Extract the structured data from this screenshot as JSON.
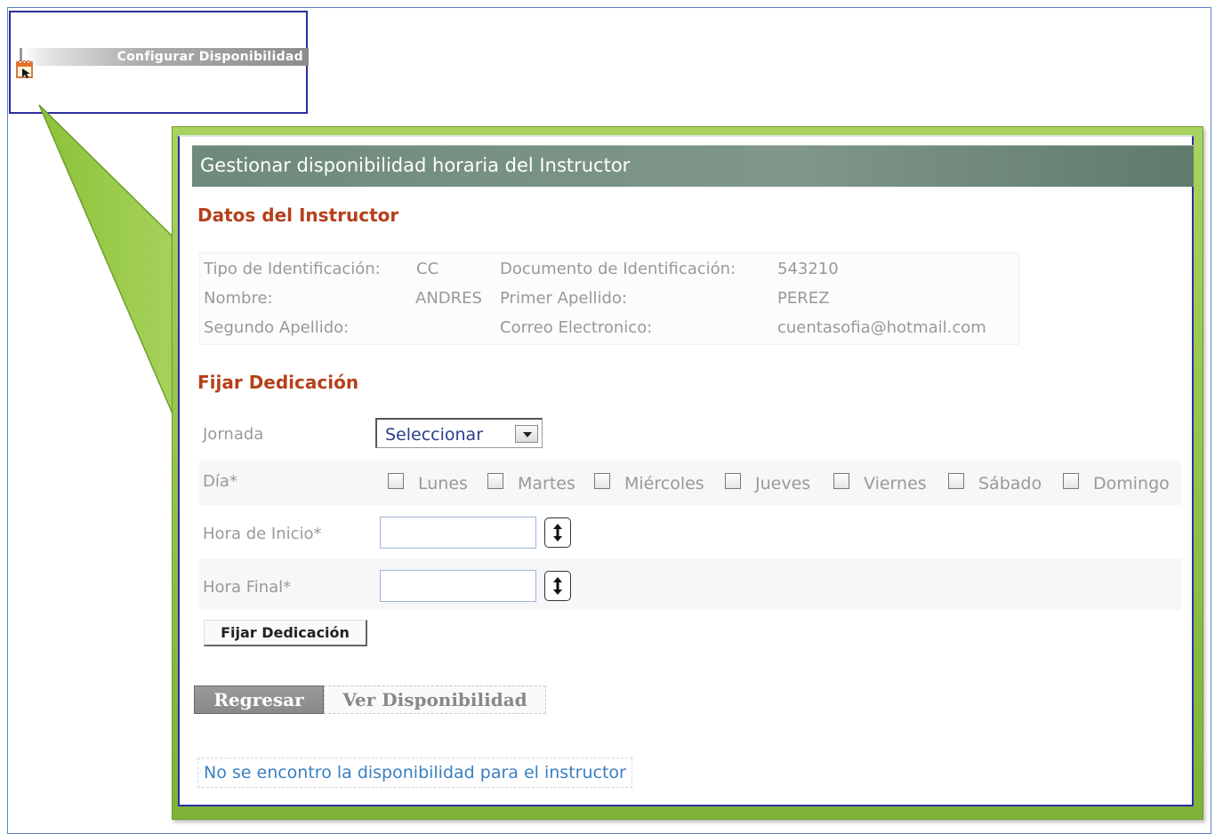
{
  "menu": {
    "title": "Configurar Disponibilidad"
  },
  "panel": {
    "title": "Gestionar disponibilidad horaria del Instructor",
    "section_instructor": "Datos del Instructor",
    "section_dedicacion": "Fijar Dedicación"
  },
  "instructor": {
    "tipo_id_label": "Tipo de Identificación:",
    "tipo_id_value": "CC",
    "documento_label": "Documento de Identificación:",
    "documento_value": "543210",
    "nombre_label": "Nombre:",
    "nombre_value": "ANDRES",
    "primer_apellido_label": "Primer Apellido:",
    "primer_apellido_value": "PEREZ",
    "segundo_apellido_label": "Segundo Apellido:",
    "segundo_apellido_value": "",
    "correo_label": "Correo Electronico:",
    "correo_value": "cuentasofia@hotmail.com"
  },
  "form": {
    "jornada_label": "Jornada",
    "jornada_selected": "Seleccionar",
    "dia_label": "Día*",
    "days": [
      "Lunes",
      "Martes",
      "Miércoles",
      "Jueves",
      "Viernes",
      "Sábado",
      "Domingo"
    ],
    "hora_inicio_label": "Hora de Inicio*",
    "hora_inicio_value": "",
    "hora_final_label": "Hora Final*",
    "hora_final_value": "",
    "fijar_button": "Fijar Dedicación"
  },
  "tabs": {
    "regresar": "Regresar",
    "ver": "Ver Disponibilidad"
  },
  "message": "No se encontro la disponibilidad para el instructor",
  "colors": {
    "section_title": "#b5401a",
    "header_bg": "#6e8a7c",
    "frame_green": "#8fc043",
    "callout_border": "#2a2f9e",
    "link_blue": "#3a7fc1"
  }
}
